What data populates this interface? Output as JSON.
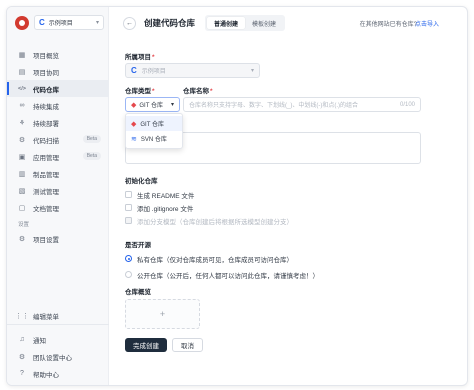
{
  "sidebar": {
    "project_name": "示例项目",
    "nav": [
      {
        "label": "项目概览",
        "icon": "overview-icon",
        "glyph": "▦"
      },
      {
        "label": "项目协同",
        "icon": "collab-icon",
        "glyph": "▤"
      },
      {
        "label": "代码仓库",
        "icon": "code-icon",
        "glyph": "</>"
      },
      {
        "label": "持续集成",
        "icon": "ci-icon",
        "glyph": "∞"
      },
      {
        "label": "持续部署",
        "icon": "deploy-icon",
        "glyph": "⚘"
      },
      {
        "label": "代码扫描",
        "icon": "scan-icon",
        "glyph": "⚙",
        "badge": "Beta"
      },
      {
        "label": "应用管理",
        "icon": "app-icon",
        "glyph": "▣",
        "badge": "Beta"
      },
      {
        "label": "制品管理",
        "icon": "artifact-icon",
        "glyph": "▥"
      },
      {
        "label": "测试管理",
        "icon": "test-icon",
        "glyph": "▧"
      },
      {
        "label": "文档管理",
        "icon": "doc-icon",
        "glyph": "▢"
      }
    ],
    "section_settings": "设置",
    "project_settings": "项目设置",
    "bottom": {
      "edit_menu": "编辑菜单",
      "notify": "通知",
      "team_settings": "团队设置中心",
      "help": "帮助中心"
    }
  },
  "header": {
    "title": "创建代码仓库",
    "tabs": [
      "普通创建",
      "模板创建"
    ],
    "import_hint": "在其他网站已有仓库?",
    "import_link": "点击导入"
  },
  "form": {
    "project_label": "所属项目",
    "project_value": "示例项目",
    "repo_type_label": "仓库类型",
    "repo_type_value": "GIT 仓库",
    "repo_name_label": "仓库名称",
    "repo_name_placeholder": "仓库名称只支持字母、数字、下划线(_)、中划线(-)和点(.)的组合",
    "repo_name_count": "0/100",
    "dropdown_options": [
      "GIT 仓库",
      "SVN 仓库"
    ],
    "init_label": "初始化仓库",
    "init_options": [
      "生成 README 文件",
      "添加 .gitignore 文件",
      "添加分支模型（仓库创建后将根据所选模型创建分支）"
    ],
    "open_label": "是否开源",
    "open_options": [
      "私有仓库（仅对仓库成员可见，仓库成员可访问仓库）",
      "公开仓库（公开后，任何人都可以访问此仓库，请谨慎考虑！）"
    ],
    "cover_label": "仓库概览",
    "submit": "完成创建",
    "cancel": "取消"
  },
  "colors": {
    "accent": "#2563eb",
    "primary_button": "#1f2d3d",
    "logo": "#d23a2f",
    "git": "#e5484d"
  }
}
